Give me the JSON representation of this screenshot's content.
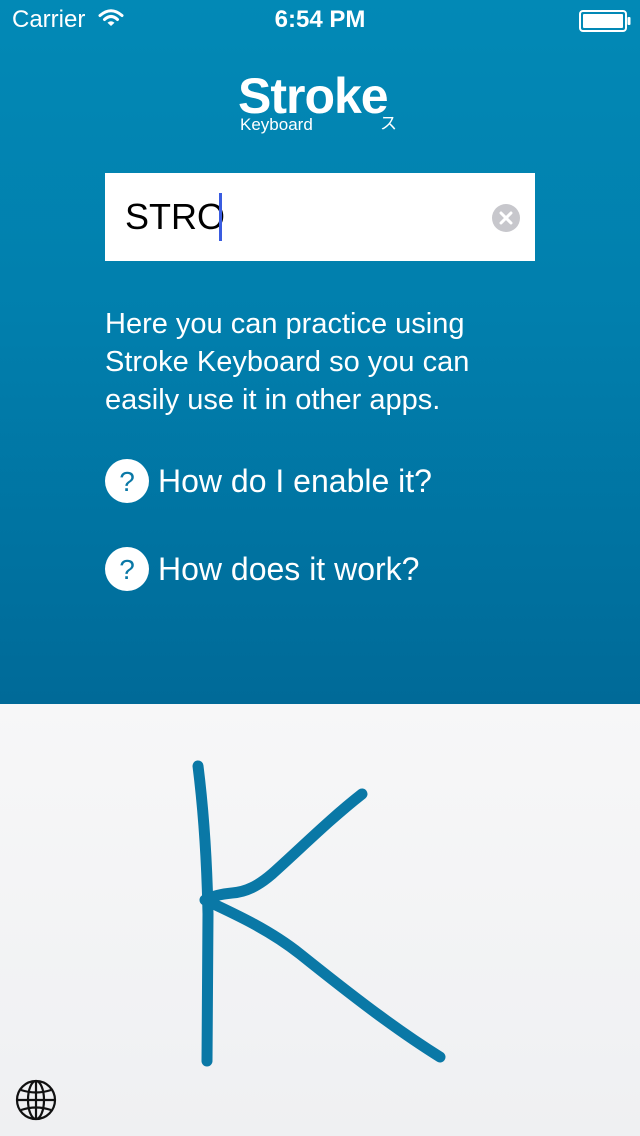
{
  "status_bar": {
    "carrier": "Carrier",
    "time": "6:54 PM",
    "icons": [
      "wifi-icon",
      "battery-icon"
    ]
  },
  "logo": {
    "title": "Stroke",
    "subtitle": "Keyboard",
    "kana": "ス"
  },
  "practice_input": {
    "value": "STRO",
    "clear_icon": "clear-icon"
  },
  "intro_text": "Here you can practice using Stroke Keyboard so you can easily use it in other apps.",
  "help_links": [
    {
      "label": "How do I enable it?",
      "icon": "question-icon"
    },
    {
      "label": "How does it work?",
      "icon": "question-icon"
    }
  ],
  "keyboard": {
    "drawn_letter": "K",
    "stroke_color": "#0a78a6",
    "globe_icon": "globe-icon"
  },
  "colors": {
    "header_top": "#0289b6",
    "header_bottom": "#006a98",
    "keyboard_bg": "#f2f3f5",
    "caret": "#3a5ce0"
  }
}
